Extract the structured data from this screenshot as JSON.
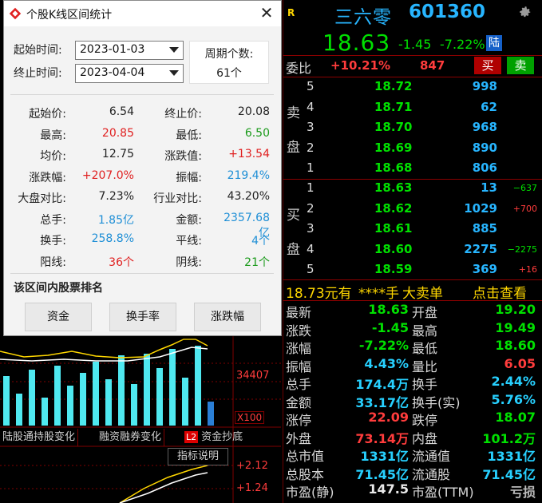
{
  "dialog": {
    "title": "个股K线区间统计",
    "start_label": "起始时间:",
    "start_value": "2023-01-03",
    "end_label": "终止时间:",
    "end_value": "2023-04-04",
    "period_label": "周期个数:",
    "period_value": "61个",
    "stats_left": [
      {
        "k": "起始价:",
        "v": "6.54",
        "c": "black"
      },
      {
        "k": "最高:",
        "v": "20.85",
        "c": "red"
      },
      {
        "k": "均价:",
        "v": "12.75",
        "c": "black"
      },
      {
        "k": "涨跌幅:",
        "v": "+207.0%",
        "c": "red"
      },
      {
        "k": "大盘对比:",
        "v": "7.23%",
        "c": "black"
      },
      {
        "k": "总手:",
        "v": "1.85亿",
        "c": "blue"
      },
      {
        "k": "换手:",
        "v": "258.8%",
        "c": "blue"
      },
      {
        "k": "阳线:",
        "v": "36个",
        "c": "red"
      }
    ],
    "stats_right": [
      {
        "k": "终止价:",
        "v": "20.08",
        "c": "black"
      },
      {
        "k": "最低:",
        "v": "6.50",
        "c": "green"
      },
      {
        "k": "涨跌值:",
        "v": "+13.54",
        "c": "red"
      },
      {
        "k": "振幅:",
        "v": "219.4%",
        "c": "blue"
      },
      {
        "k": "行业对比:",
        "v": "43.20%",
        "c": "black"
      },
      {
        "k": "金额:",
        "v": "2357.68亿",
        "c": "blue"
      },
      {
        "k": "平线:",
        "v": "4个",
        "c": "blue"
      },
      {
        "k": "阴线:",
        "v": "21个",
        "c": "green"
      }
    ],
    "rank_title": "该区间内股票排名",
    "rank_buttons": [
      "资金",
      "换手率",
      "涨跌幅"
    ]
  },
  "bg": {
    "axis_34407": "34407",
    "axis_x100": "X100",
    "tabs": [
      "陆股通持股变化",
      "融资融券变化",
      "资金抄底"
    ],
    "l2_badge": "L2",
    "indicator_button": "指标说明",
    "axis_212": "+2.12",
    "axis_124": "+1.24"
  },
  "quote": {
    "r_badge": "R",
    "name": "三六零",
    "code": "601360",
    "price": "18.63",
    "change": "-1.45",
    "change_pct": "-7.22%",
    "lu_badge": "陆",
    "weibi_label": "委比",
    "weibi_value": "+10.21%",
    "weicha_value": "847",
    "buy_btn": "买",
    "sell_btn": "卖",
    "sell_side_label": [
      "卖",
      "盘"
    ],
    "buy_side_label": [
      "买",
      "盘"
    ],
    "asks": [
      {
        "lvl": "5",
        "price": "18.72",
        "vol": "998",
        "chg": ""
      },
      {
        "lvl": "4",
        "price": "18.71",
        "vol": "62",
        "chg": ""
      },
      {
        "lvl": "3",
        "price": "18.70",
        "vol": "968",
        "chg": ""
      },
      {
        "lvl": "2",
        "price": "18.69",
        "vol": "890",
        "chg": ""
      },
      {
        "lvl": "1",
        "price": "18.68",
        "vol": "806",
        "chg": ""
      }
    ],
    "bids": [
      {
        "lvl": "1",
        "price": "18.63",
        "vol": "13",
        "chg": "−637",
        "dir": "dn"
      },
      {
        "lvl": "2",
        "price": "18.62",
        "vol": "1029",
        "chg": "+700",
        "dir": "up"
      },
      {
        "lvl": "3",
        "price": "18.61",
        "vol": "885",
        "chg": "",
        "dir": ""
      },
      {
        "lvl": "4",
        "price": "18.60",
        "vol": "2275",
        "chg": "−2275",
        "dir": "dn"
      },
      {
        "lvl": "5",
        "price": "18.59",
        "vol": "369",
        "chg": "+16",
        "dir": "up"
      }
    ],
    "ticker_price": "18.73元有",
    "ticker_stars": "****手",
    "ticker_big": "大卖单",
    "ticker_link": "点击查看",
    "stats": [
      {
        "k1": "最新",
        "v1": "18.63",
        "c1": "green",
        "k2": "开盘",
        "v2": "19.20",
        "c2": "green"
      },
      {
        "k1": "涨跌",
        "v1": "-1.45",
        "c1": "green",
        "k2": "最高",
        "v2": "19.49",
        "c2": "green"
      },
      {
        "k1": "涨幅",
        "v1": "-7.22%",
        "c1": "green",
        "k2": "最低",
        "v2": "18.60",
        "c2": "green"
      },
      {
        "k1": "振幅",
        "v1": "4.43%",
        "c1": "cyan",
        "k2": "量比",
        "v2": "6.05",
        "c2": "red"
      },
      {
        "k1": "总手",
        "v1": "174.4万",
        "c1": "cyan",
        "k2": "换手",
        "v2": "2.44%",
        "c2": "cyan"
      },
      {
        "k1": "金额",
        "v1": "33.17亿",
        "c1": "cyan",
        "k2": "换手(实)",
        "v2": "5.76%",
        "c2": "cyan"
      },
      {
        "k1": "涨停",
        "v1": "22.09",
        "c1": "red",
        "k2": "跌停",
        "v2": "18.07",
        "c2": "green"
      },
      {
        "k1": "外盘",
        "v1": "73.14万",
        "c1": "red",
        "k2": "内盘",
        "v2": "101.2万",
        "c2": "green"
      },
      {
        "k1": "总市值",
        "v1": "1331亿",
        "c1": "cyan",
        "k2": "流通值",
        "v2": "1331亿",
        "c2": "cyan"
      },
      {
        "k1": "总股本",
        "v1": "71.45亿",
        "c1": "cyan",
        "k2": "流通股",
        "v2": "71.45亿",
        "c2": "cyan"
      },
      {
        "k1": "市盈(静)",
        "v1": "147.5",
        "c1": "white",
        "k2": "市盈(TTM)",
        "v2": "亏损",
        "c2": "gray"
      }
    ]
  }
}
